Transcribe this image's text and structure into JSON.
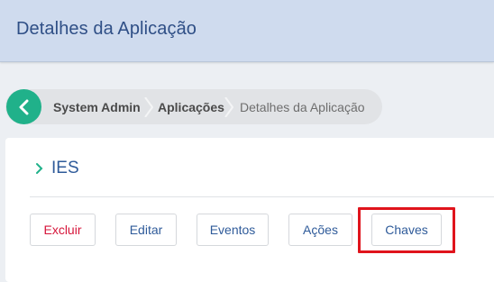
{
  "header": {
    "title": "Detalhes da Aplicação"
  },
  "breadcrumb": {
    "items": [
      {
        "label": "System Admin"
      },
      {
        "label": "Aplicações"
      },
      {
        "label": "Detalhes da Aplicação"
      }
    ]
  },
  "application": {
    "name": "IES"
  },
  "actions": {
    "delete_label": "Excluir",
    "edit_label": "Editar",
    "events_label": "Eventos",
    "actions_label": "Ações",
    "keys_label": "Chaves"
  },
  "colors": {
    "header_bg": "#cfdbee",
    "accent_green": "#20b18a",
    "primary_blue": "#2f5b9a",
    "danger_red": "#d6163b",
    "highlight_red": "#e0141c"
  }
}
